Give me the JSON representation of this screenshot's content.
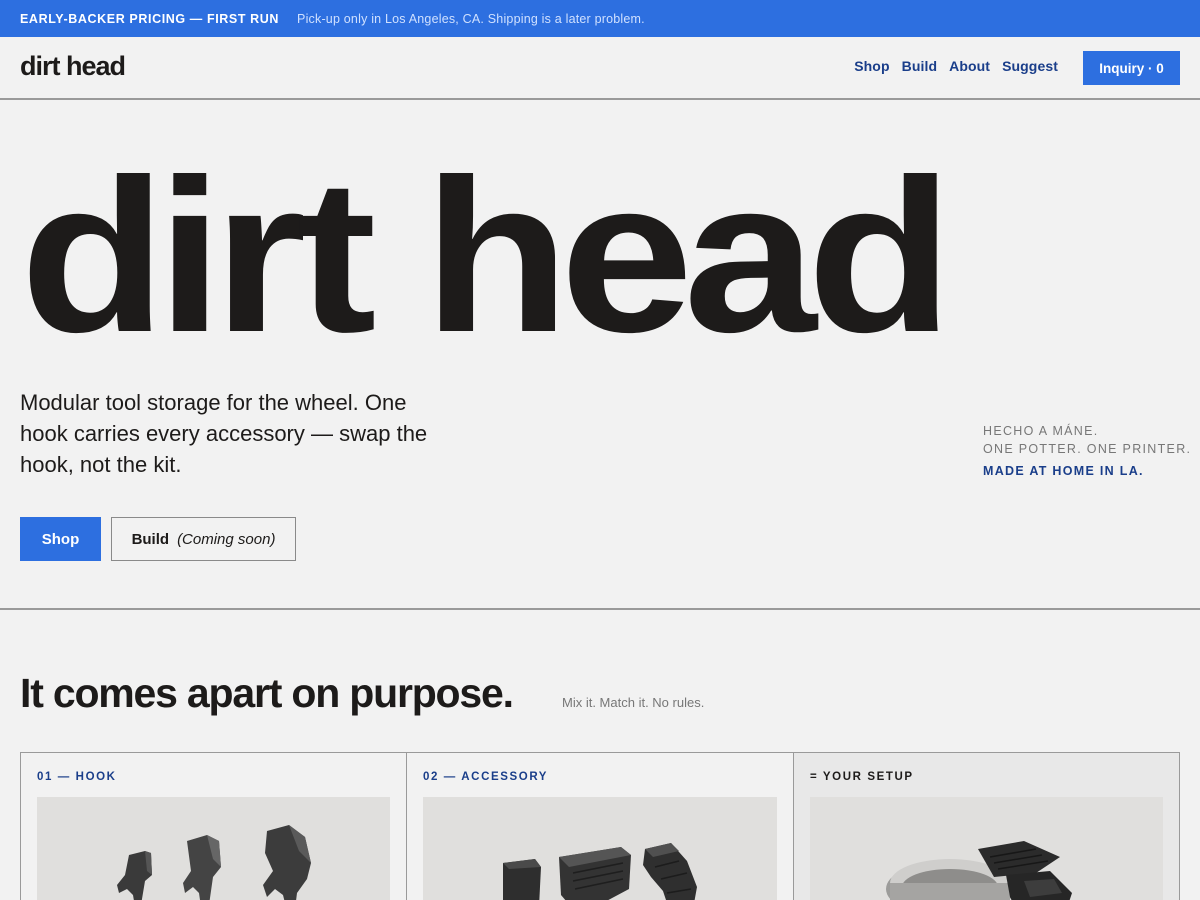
{
  "announcement": {
    "promo": "EARLY-BACKER PRICING — FIRST RUN",
    "note": "Pick-up only in Los Angeles, CA. Shipping is a later problem."
  },
  "header": {
    "logo": "dirt head",
    "nav": [
      "Shop",
      "Build",
      "About",
      "Suggest"
    ],
    "inquiry_label": "Inquiry · 0"
  },
  "hero": {
    "wordmark": "dirt head",
    "description": "Modular tool storage for the wheel. One hook carries every accessory — swap the hook, not the kit.",
    "shop_label": "Shop",
    "build_label": "Build",
    "build_note": "(Coming soon)",
    "made": {
      "line1": "HECHO A MÁNE.",
      "line2": "ONE POTTER. ONE PRINTER.",
      "line3": "MADE AT HOME IN LA."
    }
  },
  "section": {
    "title": "It comes apart on purpose.",
    "subtitle": "Mix it. Match it. No rules.",
    "cards": [
      {
        "label": "01 — HOOK",
        "image": "hook-parts-image"
      },
      {
        "label": "02 — ACCESSORY",
        "image": "accessory-parts-image"
      },
      {
        "label": "= YOUR SETUP",
        "image": "assembled-setup-image"
      }
    ]
  },
  "colors": {
    "accent": "#2d6fe0",
    "link": "#1a3e8a",
    "text": "#1d1b1a",
    "background": "#f2f2f2"
  }
}
